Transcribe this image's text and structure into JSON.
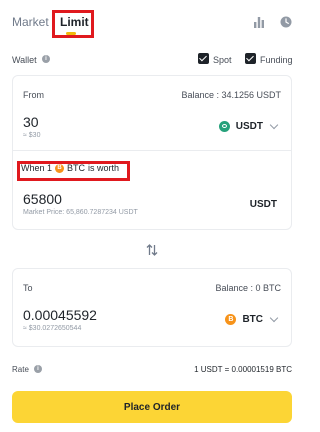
{
  "tabs": {
    "market": "Market",
    "limit": "Limit"
  },
  "icons": {
    "chart": "bar-chart-icon",
    "history": "clock-icon",
    "info": "info-icon",
    "swap": "swap-vertical-icon"
  },
  "wallet": {
    "label": "Wallet",
    "spot": "Spot",
    "funding": "Funding",
    "spot_checked": true,
    "funding_checked": true
  },
  "from": {
    "label": "From",
    "balance": "Balance : 34.1256 USDT",
    "amount": "30",
    "approx": "≈ $30",
    "asset": "USDT",
    "asset_color": "#26a17b"
  },
  "limit_price": {
    "prefix": "When 1",
    "asset": "BTC",
    "suffix": "is worth",
    "value": "65800",
    "market_price": "Market Price: 65,860.7287234 USDT",
    "unit": "USDT"
  },
  "to": {
    "label": "To",
    "balance": "Balance : 0 BTC",
    "amount": "0.00045592",
    "approx": "≈ $30.0272650544",
    "asset": "BTC",
    "asset_color": "#f7931a"
  },
  "rate": {
    "label": "Rate",
    "value": "1 USDT = 0.00001519 BTC"
  },
  "place_order": "Place Order",
  "colors": {
    "accent": "#f0b90b",
    "button": "#fcd535",
    "highlight": "#e0191e"
  }
}
